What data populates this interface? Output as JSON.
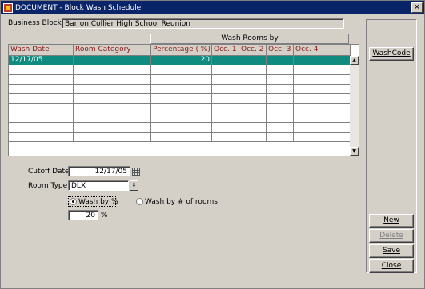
{
  "window": {
    "title": "DOCUMENT - Block Wash Schedule"
  },
  "business_block": {
    "label": "Business Block",
    "value": "Barron Collier High School Reunion"
  },
  "grid": {
    "group_header": "Wash Rooms by",
    "columns": [
      "Wash Date",
      "Room Category",
      "Percentage ( %)",
      "Occ. 1",
      "Occ. 2",
      "Occ. 3",
      "Occ. 4"
    ],
    "rows": [
      [
        "12/17/05",
        "",
        "20",
        "",
        "",
        "",
        ""
      ],
      [
        "",
        "",
        "",
        "",
        "",
        "",
        ""
      ],
      [
        "",
        "",
        "",
        "",
        "",
        "",
        ""
      ],
      [
        "",
        "",
        "",
        "",
        "",
        "",
        ""
      ],
      [
        "",
        "",
        "",
        "",
        "",
        "",
        ""
      ],
      [
        "",
        "",
        "",
        "",
        "",
        "",
        ""
      ],
      [
        "",
        "",
        "",
        "",
        "",
        "",
        ""
      ],
      [
        "",
        "",
        "",
        "",
        "",
        "",
        ""
      ],
      [
        "",
        "",
        "",
        "",
        "",
        "",
        ""
      ]
    ],
    "selected_row": 0
  },
  "form": {
    "cutoff_label": "Cutoff Date",
    "cutoff_value": "12/17/05",
    "room_type_label": "Room Type",
    "room_type_value": "DLX",
    "wash_by_pct_label": "Wash by %",
    "wash_by_rooms_label": "Wash by # of rooms",
    "wash_mode": "percent",
    "pct_value": "20",
    "pct_suffix": "%"
  },
  "buttons": {
    "washcode": "WashCode",
    "new": "New",
    "delete": "Delete",
    "save": "Save",
    "close": "Close"
  },
  "colors": {
    "title_bar": "#0a246a",
    "selected_row": "#0f8b80",
    "header_text": "#8b1a1a"
  }
}
